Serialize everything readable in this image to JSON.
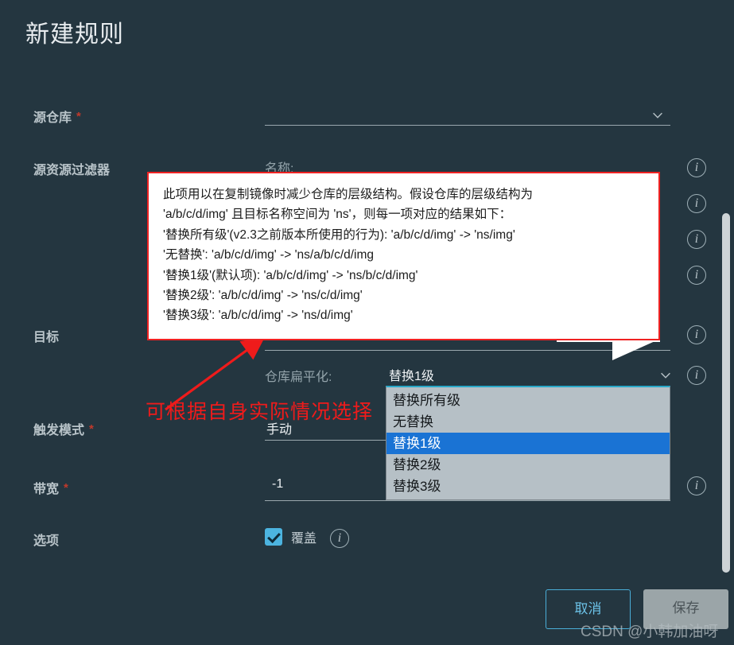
{
  "modal": {
    "title": "新建规则"
  },
  "fields": {
    "source_registry": {
      "label": "源仓库",
      "required_marker": "*",
      "value": "",
      "chevron_icon": "chevron-down-icon"
    },
    "source_filter": {
      "label": "源资源过滤器",
      "name_sub_label": "名称:"
    },
    "destination": {
      "label": "目标",
      "flatten_sub_label": "仓库扁平化:",
      "flatten_value": "替换1级"
    },
    "trigger_mode": {
      "label": "触发模式",
      "required_marker": "*",
      "value": "手动"
    },
    "bandwidth": {
      "label": "带宽",
      "required_marker": "*",
      "value": "-1"
    },
    "options": {
      "label": "选项",
      "override_label": "覆盖",
      "override_checked": true
    }
  },
  "dropdown": {
    "options": [
      "替换所有级",
      "无替换",
      "替换1级",
      "替换2级",
      "替换3级"
    ],
    "selected_index": 2
  },
  "tooltip": {
    "lines": [
      "此项用以在复制镜像时减少仓库的层级结构。假设仓库的层级结构为",
      "'a/b/c/d/img' 且目标名称空间为 'ns'，则每一项对应的结果如下：",
      "'替换所有级'(v2.3之前版本所使用的行为): 'a/b/c/d/img' -> 'ns/img'",
      "'无替换': 'a/b/c/d/img' -> 'ns/a/b/c/d/img",
      "'替换1级'(默认项): 'a/b/c/d/img' -> 'ns/b/c/d/img'",
      "'替换2级': 'a/b/c/d/img' -> 'ns/c/d/img'",
      "'替换3级': 'a/b/c/d/img' -> 'ns/d/img'"
    ]
  },
  "annotation": {
    "text": "可根据自身实际情况选择",
    "color": "#ef1b1b"
  },
  "footer": {
    "cancel_label": "取消",
    "save_label": "保存"
  },
  "watermark": {
    "text": "CSDN @小韩加油呀"
  },
  "colors": {
    "background": "#243640",
    "label": "#b9c4c9",
    "accent_blue": "#4aaed8",
    "dropdown_selected": "#1a73d4",
    "dropdown_bg": "#b6c0c6",
    "required_star": "#c0392b",
    "annotation_red": "#ef1b1b",
    "checkbox": "#4cb4e0"
  },
  "icons": {
    "info": "i",
    "info_name": "info-icon",
    "chevron_name": "chevron-down-icon",
    "check_name": "check-icon"
  }
}
